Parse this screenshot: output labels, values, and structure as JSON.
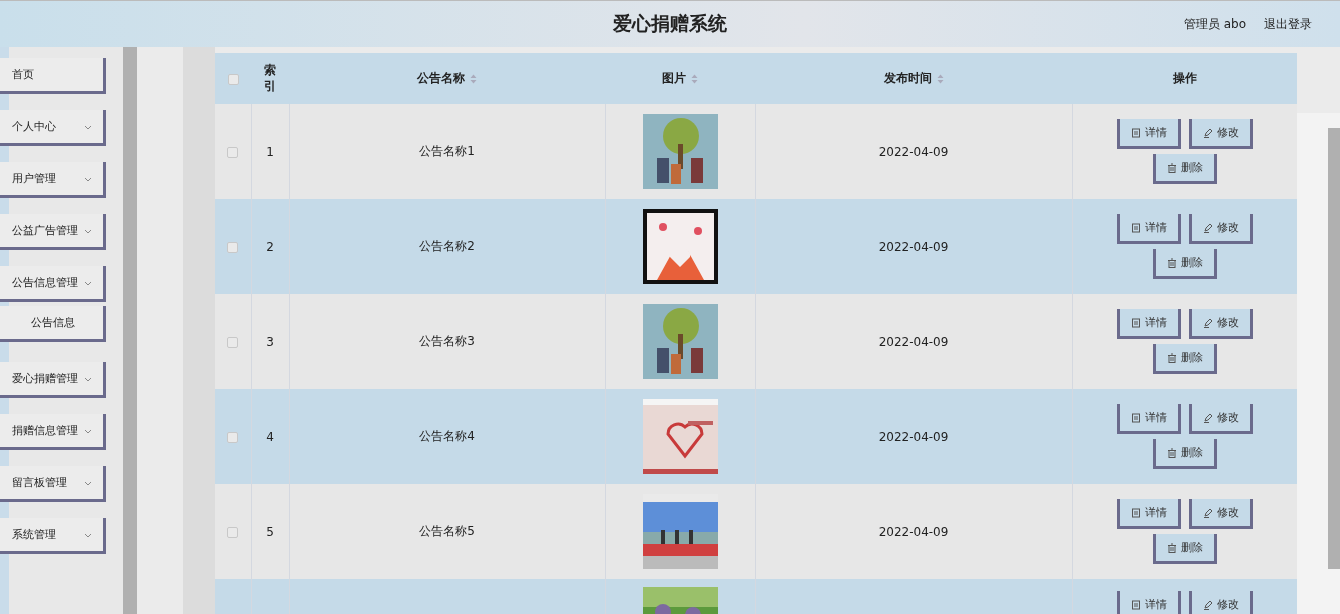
{
  "header": {
    "title": "爱心捐赠系统",
    "user": "管理员 abo",
    "logout": "退出登录"
  },
  "sidebar": {
    "items": [
      {
        "label": "首页",
        "kind": "link"
      },
      {
        "label": "个人中心",
        "kind": "menu"
      },
      {
        "label": "用户管理",
        "kind": "menu"
      },
      {
        "label": "公益广告管理",
        "kind": "menu"
      },
      {
        "label": "公告信息管理",
        "kind": "menu",
        "children": [
          {
            "label": "公告信息"
          }
        ]
      },
      {
        "label": "爱心捐赠管理",
        "kind": "menu"
      },
      {
        "label": "捐赠信息管理",
        "kind": "menu"
      },
      {
        "label": "留言板管理",
        "kind": "menu"
      },
      {
        "label": "系统管理",
        "kind": "menu"
      }
    ]
  },
  "table": {
    "select_all": {
      "checked": false
    },
    "columns": [
      {
        "label": "索引",
        "sortable": false
      },
      {
        "label": "公告名称",
        "sortable": true
      },
      {
        "label": "图片",
        "sortable": true
      },
      {
        "label": "发布时间",
        "sortable": true
      },
      {
        "label": "操作",
        "sortable": false
      }
    ],
    "rows": [
      {
        "checked": false,
        "index": "1",
        "name": "公告名称1",
        "image": {
          "kind": "picture"
        },
        "date": "2022-04-09",
        "actions": [
          "详情",
          "修改",
          "删除"
        ]
      },
      {
        "checked": false,
        "index": "2",
        "name": "公告名称2",
        "image": {
          "kind": "picture"
        },
        "date": "2022-04-09",
        "actions": [
          "详情",
          "修改",
          "删除"
        ]
      },
      {
        "checked": false,
        "index": "3",
        "name": "公告名称3",
        "image": {
          "kind": "picture"
        },
        "date": "2022-04-09",
        "actions": [
          "详情",
          "修改",
          "删除"
        ]
      },
      {
        "checked": false,
        "index": "4",
        "name": "公告名称4",
        "image": {
          "kind": "picture"
        },
        "date": "2022-04-09",
        "actions": [
          "详情",
          "修改",
          "删除"
        ]
      },
      {
        "checked": false,
        "index": "5",
        "name": "公告名称5",
        "image": {
          "kind": "picture"
        },
        "date": "2022-04-09",
        "actions": [
          "详情",
          "修改",
          "删除"
        ]
      }
    ],
    "partial_row": {
      "image": {
        "kind": "picture"
      },
      "actions": [
        "详情",
        "修改"
      ]
    }
  }
}
